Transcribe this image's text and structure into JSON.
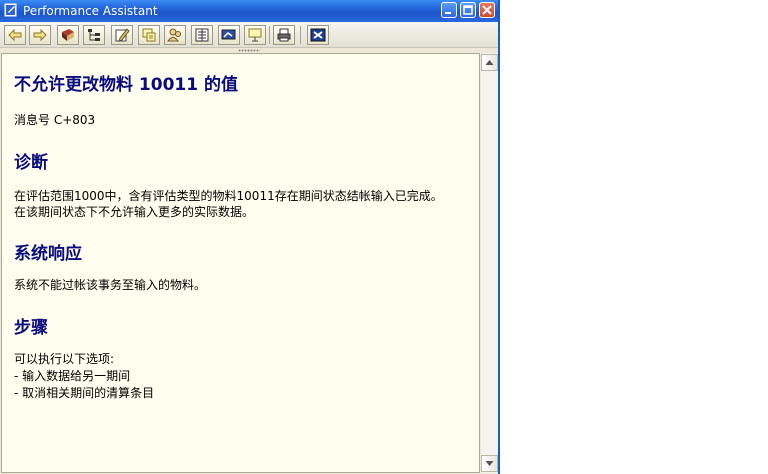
{
  "window": {
    "title": "Performance Assistant"
  },
  "toolbar": {
    "buttons": [
      {
        "icon": "back-arrow-icon"
      },
      {
        "icon": "forward-arrow-icon"
      },
      {
        "icon": "book-icon"
      },
      {
        "icon": "structure-icon"
      },
      {
        "icon": "edit-icon"
      },
      {
        "icon": "notes-icon"
      },
      {
        "icon": "users-icon"
      },
      {
        "icon": "document-icon"
      },
      {
        "icon": "flag-icon"
      },
      {
        "icon": "link-icon"
      },
      {
        "icon": "printer-icon"
      },
      {
        "icon": "close-x-icon"
      }
    ]
  },
  "content": {
    "title": "不允许更改物料 10011 的值",
    "message_no": "消息号 C+803",
    "diagnosis_heading": "诊断",
    "diagnosis_line1": "在评估范围1000中，含有评估类型的物料10011存在期间状态结帐输入已完成。",
    "diagnosis_line2": "在该期间状态下不允许输入更多的实际数据。",
    "response_heading": "系统响应",
    "response_text": "系统不能过帐该事务至输入的物料。",
    "procedure_heading": "步骤",
    "procedure_intro": "可以执行以下选项:",
    "procedure_item1": "- 输入数据给另一期间",
    "procedure_item2": "- 取消相关期间的清算条目"
  },
  "colors": {
    "heading": "#0b0b80",
    "background": "#ffffef",
    "titlebar": "#1f5fd6"
  }
}
